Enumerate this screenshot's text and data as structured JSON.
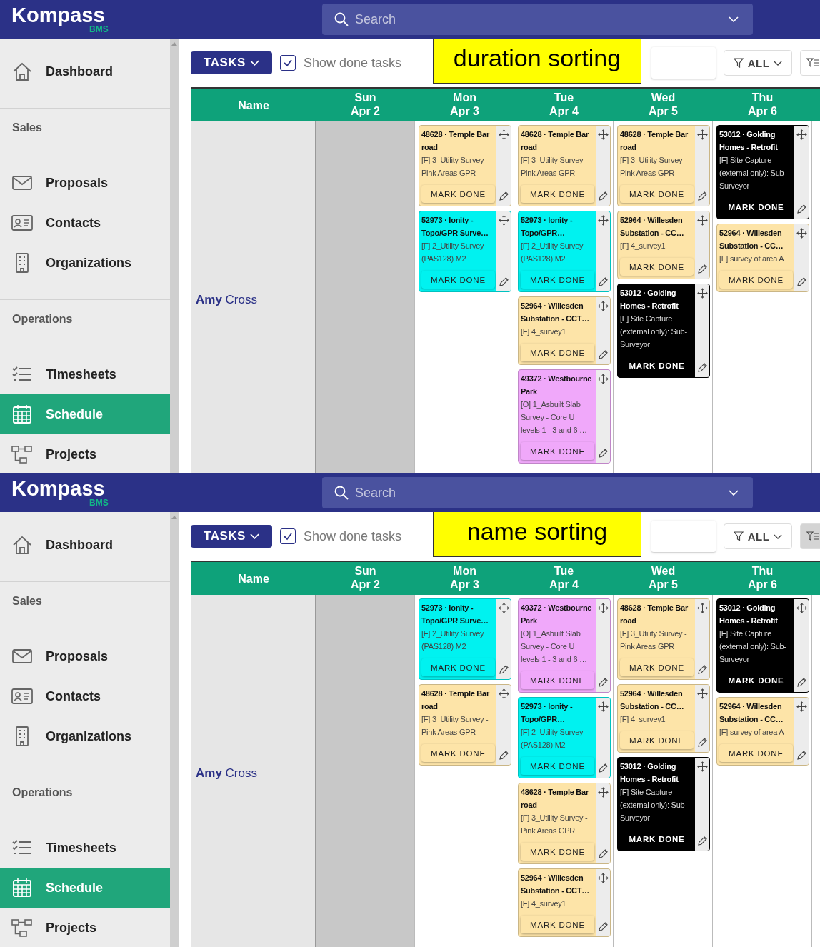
{
  "panels": [
    {
      "app": {
        "logo": "Kompass",
        "logo_sub": "BMS",
        "search_placeholder": "Search"
      },
      "sidebar": [
        {
          "kind": "item",
          "label": "Dashboard",
          "selected": false
        },
        {
          "kind": "section",
          "label": "Sales"
        },
        {
          "kind": "item",
          "label": "Proposals",
          "selected": false
        },
        {
          "kind": "item",
          "label": "Contacts",
          "selected": false
        },
        {
          "kind": "item",
          "label": "Organizations",
          "selected": false
        },
        {
          "kind": "section",
          "label": "Operations"
        },
        {
          "kind": "item",
          "label": "Timesheets",
          "selected": false
        },
        {
          "kind": "item",
          "label": "Schedule",
          "selected": true
        },
        {
          "kind": "item",
          "label": "Projects",
          "selected": false
        }
      ],
      "toolbar": {
        "tasks_button": "TASKS",
        "show_done": {
          "label": "Show done tasks",
          "checked": true
        },
        "filter_button": "ALL",
        "filter_list_selected": false
      },
      "callout": "duration sorting",
      "schedule": {
        "name_header": "Name",
        "person": "**Amy** Cross",
        "days": [
          {
            "weekday": "Sun",
            "date": "Apr 2",
            "shaded": true
          },
          {
            "weekday": "Mon",
            "date": "Apr 3",
            "shaded": false,
            "cards": [
              {
                "title": "48628 · Temple Bar road",
                "task": "[F] 3_Utility Survey - Pink Areas GPR",
                "button": "MARK DONE",
                "color": "#fde4a8"
              },
              {
                "title": "52973 · Ionity - Topo/GPR Surve…",
                "task": "[F] 2_Utility Survey (PAS128) M2",
                "button": "MARK DONE",
                "color": "#00f2f0"
              }
            ]
          },
          {
            "weekday": "Tue",
            "date": "Apr 4",
            "shaded": false,
            "cards": [
              {
                "title": "48628 · Temple Bar road",
                "task": "[F] 3_Utility Survey - Pink Areas GPR",
                "button": "MARK DONE",
                "color": "#fde4a8"
              },
              {
                "title": "52973 · Ionity - Topo/GPR…",
                "task": "[F] 2_Utility Survey (PAS128) M2",
                "button": "MARK DONE",
                "color": "#00f2f0"
              },
              {
                "title": "52964 · Willesden Substation - CCT…",
                "task": "[F] 4_survey1",
                "button": "MARK DONE",
                "color": "#fde4a8"
              },
              {
                "title": "49372 · Westbourne Park",
                "task": "[O] 1_Asbuilt Slab Survey - Core U levels 1 - 3 and 6 …",
                "button": "MARK DONE",
                "color": "#f0a8fa"
              }
            ]
          },
          {
            "weekday": "Wed",
            "date": "Apr 5",
            "shaded": false,
            "cards": [
              {
                "title": "48628 · Temple Bar road",
                "task": "[F] 3_Utility Survey - Pink Areas GPR",
                "button": "MARK DONE",
                "color": "#fde4a8"
              },
              {
                "title": "52964 · Willesden Substation - CC…",
                "task": "[F] 4_survey1",
                "button": "MARK DONE",
                "color": "#fde4a8"
              },
              {
                "title": "53012 · Golding Homes - Retrofit",
                "task": "[F] Site Capture (external only): Sub-Surveyor",
                "button": "MARK DONE",
                "color": "#000000"
              }
            ]
          },
          {
            "weekday": "Thu",
            "date": "Apr 6",
            "shaded": false,
            "cards": [
              {
                "title": "53012 · Golding Homes - Retrofit",
                "task": "[F] Site Capture (external only): Sub-Surveyor",
                "button": "MARK DONE",
                "color": "#000000"
              },
              {
                "title": "52964 · Willesden Substation - CC…",
                "task": "[F] survey of area A",
                "button": "MARK DONE",
                "color": "#fde4a8"
              }
            ]
          }
        ]
      }
    },
    {
      "app": {
        "logo": "Kompass",
        "logo_sub": "BMS",
        "search_placeholder": "Search"
      },
      "sidebar": [
        {
          "kind": "item",
          "label": "Dashboard",
          "selected": false
        },
        {
          "kind": "section",
          "label": "Sales"
        },
        {
          "kind": "item",
          "label": "Proposals",
          "selected": false
        },
        {
          "kind": "item",
          "label": "Contacts",
          "selected": false
        },
        {
          "kind": "item",
          "label": "Organizations",
          "selected": false
        },
        {
          "kind": "section",
          "label": "Operations"
        },
        {
          "kind": "item",
          "label": "Timesheets",
          "selected": false
        },
        {
          "kind": "item",
          "label": "Schedule",
          "selected": true
        },
        {
          "kind": "item",
          "label": "Projects",
          "selected": false
        }
      ],
      "toolbar": {
        "tasks_button": "TASKS",
        "show_done": {
          "label": "Show done tasks",
          "checked": true
        },
        "filter_button": "ALL",
        "filter_list_selected": true
      },
      "callout": "name sorting",
      "schedule": {
        "name_header": "Name",
        "person": "**Amy** Cross",
        "days": [
          {
            "weekday": "Sun",
            "date": "Apr 2",
            "shaded": true
          },
          {
            "weekday": "Mon",
            "date": "Apr 3",
            "shaded": false,
            "cards": [
              {
                "title": "52973 · Ionity - Topo/GPR Surve…",
                "task": "[F] 2_Utility Survey (PAS128) M2",
                "button": "MARK DONE",
                "color": "#00f2f0"
              },
              {
                "title": "48628 · Temple Bar road",
                "task": "[F] 3_Utility Survey - Pink Areas GPR",
                "button": "MARK DONE",
                "color": "#fde4a8"
              }
            ]
          },
          {
            "weekday": "Tue",
            "date": "Apr 4",
            "shaded": false,
            "cards": [
              {
                "title": "49372 · Westbourne Park",
                "task": "[O] 1_Asbuilt Slab Survey - Core U levels 1 - 3 and 6 …",
                "button": "MARK DONE",
                "color": "#f0a8fa"
              },
              {
                "title": "52973 · Ionity - Topo/GPR…",
                "task": "[F] 2_Utility Survey (PAS128) M2",
                "button": "MARK DONE",
                "color": "#00f2f0"
              },
              {
                "title": "48628 · Temple Bar road",
                "task": "[F] 3_Utility Survey - Pink Areas GPR",
                "button": "MARK DONE",
                "color": "#fde4a8"
              },
              {
                "title": "52964 · Willesden Substation - CCT…",
                "task": "[F] 4_survey1",
                "button": "MARK DONE",
                "color": "#fde4a8"
              }
            ]
          },
          {
            "weekday": "Wed",
            "date": "Apr 5",
            "shaded": false,
            "cards": [
              {
                "title": "48628 · Temple Bar road",
                "task": "[F] 3_Utility Survey - Pink Areas GPR",
                "button": "MARK DONE",
                "color": "#fde4a8"
              },
              {
                "title": "52964 · Willesden Substation - CC…",
                "task": "[F] 4_survey1",
                "button": "MARK DONE",
                "color": "#fde4a8"
              },
              {
                "title": "53012 · Golding Homes - Retrofit",
                "task": "[F] Site Capture (external only): Sub-Surveyor",
                "button": "MARK DONE",
                "color": "#000000"
              }
            ]
          },
          {
            "weekday": "Thu",
            "date": "Apr 6",
            "shaded": false,
            "cards": [
              {
                "title": "53012 · Golding Homes - Retrofit",
                "task": "[F] Site Capture (external only): Sub-Surveyor",
                "button": "MARK DONE",
                "color": "#000000"
              },
              {
                "title": "52964 · Willesden Substation - CC…",
                "task": "[F] survey of area A",
                "button": "MARK DONE",
                "color": "#fde4a8"
              }
            ]
          }
        ]
      }
    }
  ]
}
